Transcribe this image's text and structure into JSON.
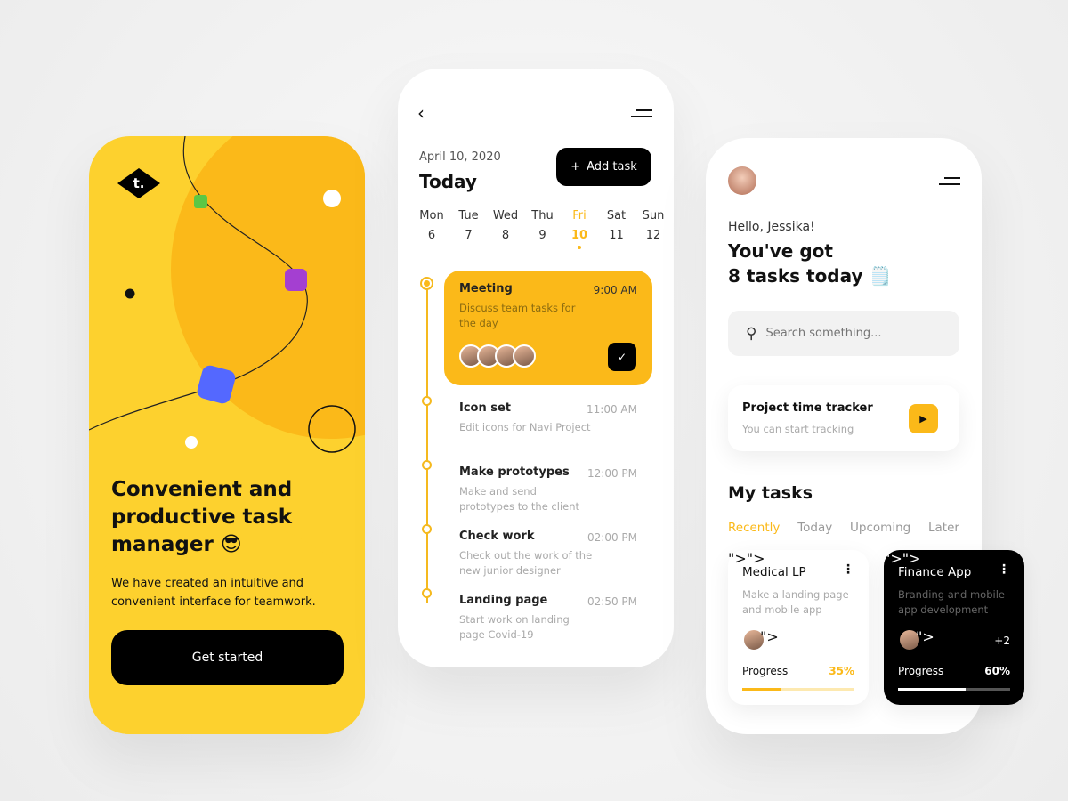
{
  "onboarding": {
    "logo": "t.",
    "title_lines": [
      "Convenient and",
      "productive task",
      "manager 😎"
    ],
    "subtitle_lines": [
      "We have created an intuitive and",
      "convenient interface for teamwork."
    ],
    "cta": "Get started"
  },
  "schedule": {
    "back_icon": "chevron-left-icon",
    "menu_icon": "menu-icon",
    "date": "April 10, 2020",
    "heading": "Today",
    "add_task": "Add task",
    "days": [
      {
        "d": "Mon",
        "n": "6"
      },
      {
        "d": "Tue",
        "n": "7"
      },
      {
        "d": "Wed",
        "n": "8"
      },
      {
        "d": "Thu",
        "n": "9"
      },
      {
        "d": "Fri",
        "n": "10",
        "active": true
      },
      {
        "d": "Sat",
        "n": "11"
      },
      {
        "d": "Sun",
        "n": "12"
      }
    ],
    "tasks": [
      {
        "title": "Meeting",
        "time": "9:00 AM",
        "desc": "Discuss team tasks for the day",
        "active": true
      },
      {
        "title": "Icon set",
        "time": "11:00 AM",
        "desc": "Edit icons for Navi Project"
      },
      {
        "title": "Make prototypes",
        "time": "12:00 PM",
        "desc": "Make and send prototypes to the client"
      },
      {
        "title": "Check work",
        "time": "02:00 PM",
        "desc": "Check out the work of the new junior designer"
      },
      {
        "title": "Landing page",
        "time": "02:50 PM",
        "desc": "Start work on landing page Covid-19"
      }
    ]
  },
  "dashboard": {
    "greeting": "Hello, Jessika!",
    "headline_1": "You've got",
    "headline_2": "8 tasks today 🗒️",
    "search_placeholder": "Search something...",
    "tracker": {
      "title": "Project time tracker",
      "subtitle": "You can start tracking"
    },
    "my_tasks": "My tasks",
    "tabs": [
      "Recently",
      "Today",
      "Upcoming",
      "Later"
    ],
    "active_tab": "Recently",
    "cards": [
      {
        "title": "Medical LP",
        "desc": "Make a landing page and mobile app",
        "progress_label": "Progress",
        "progress": "35%",
        "progress_value": 35,
        "extra": ""
      },
      {
        "title": "Finance App",
        "desc": "Branding and mobile app development",
        "progress_label": "Progress",
        "progress": "60%",
        "progress_value": 60,
        "extra": "+2"
      }
    ]
  },
  "colors": {
    "accent": "#fbb919",
    "yellow": "#fdd12e",
    "dark": "#000000"
  }
}
